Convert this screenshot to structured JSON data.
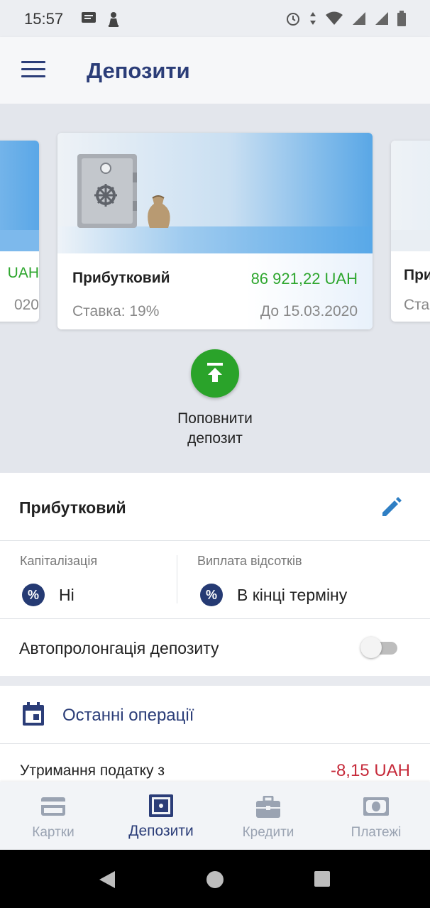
{
  "status_bar": {
    "time": "15:57"
  },
  "app_bar": {
    "title": "Депозити"
  },
  "carousel": {
    "main_card": {
      "name": "Прибутковий",
      "amount": "86 921,22 UAH",
      "rate": "Ставка: 19%",
      "until": "До 15.03.2020"
    },
    "left_card": {
      "amount": "UAH",
      "date": "020"
    },
    "right_card": {
      "name": "При",
      "rate": "Ста"
    }
  },
  "topup": {
    "label_line1": "Поповнити",
    "label_line2": "депозит"
  },
  "details": {
    "title": "Прибутковий",
    "capitalization_label": "Капіталізація",
    "capitalization_value": "Ні",
    "interest_label": "Виплата відсотків",
    "interest_value": "В кінці терміну",
    "autoprolong_label": "Автопролонгація депозиту",
    "autoprolong_on": false
  },
  "operations": {
    "title": "Останні операції",
    "items": [
      {
        "name": "Утримання податку з",
        "amount": "-8,15 UAH"
      }
    ]
  },
  "bottom_nav": {
    "items": [
      {
        "label": "Картки",
        "icon": "card-icon"
      },
      {
        "label": "Депозити",
        "icon": "safe-icon",
        "active": true
      },
      {
        "label": "Кредити",
        "icon": "briefcase-icon"
      },
      {
        "label": "Платежі",
        "icon": "banknote-icon"
      }
    ]
  },
  "colors": {
    "primary": "#2b3d78",
    "positive": "#2ea62e",
    "negative": "#c62a3a",
    "accent_button": "#2aa32a"
  }
}
